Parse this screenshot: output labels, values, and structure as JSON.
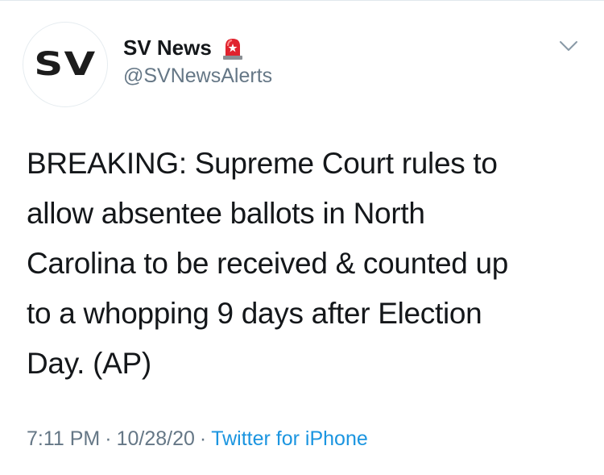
{
  "account": {
    "avatar_text": "SV",
    "display_name": "SV News",
    "handle": "@SVNewsAlerts",
    "badge_icon": "siren-icon"
  },
  "tweet": {
    "lines": [
      "BREAKING: Supreme Court rules to",
      "allow absentee ballots in North",
      "Carolina to be received & counted up",
      "to a whopping 9 days after Election",
      "Day. (AP)"
    ]
  },
  "meta": {
    "time": "7:11 PM",
    "date": "10/28/20",
    "separator": "·",
    "source": "Twitter for iPhone"
  },
  "colors": {
    "text": "#14171a",
    "secondary": "#657786",
    "link": "#1b95e0",
    "siren": "#e0232e"
  },
  "icons": [
    "siren-icon",
    "chevron-down-icon"
  ]
}
